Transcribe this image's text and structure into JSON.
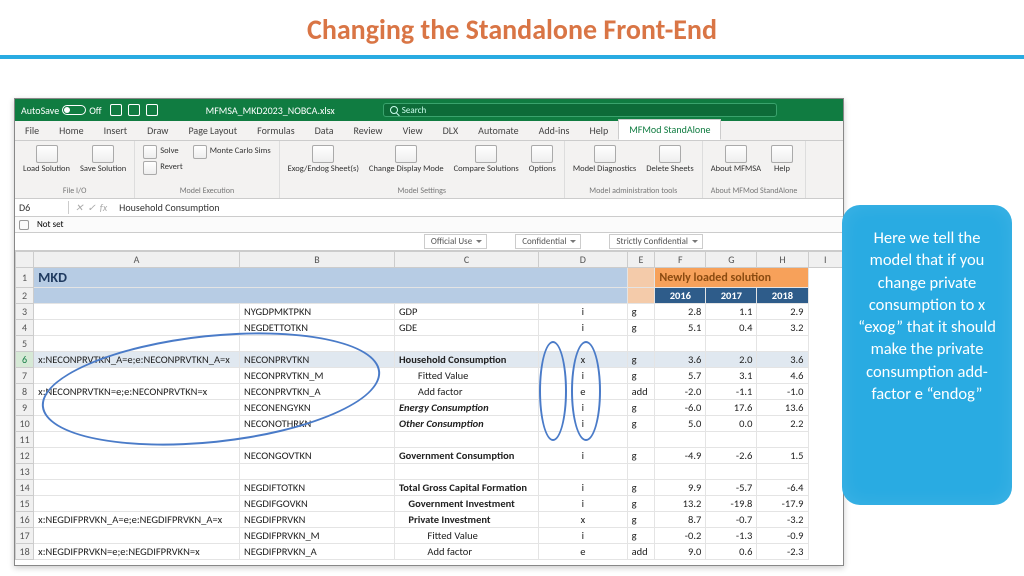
{
  "slide": {
    "title": "Changing the Standalone Front-End"
  },
  "callout": {
    "text": "Here we tell the model that if you change private consumption to x “exog” that it should make the private consumption add-factor e “endog”"
  },
  "titlebar": {
    "autosave": "AutoSave",
    "autosave_state": "Off",
    "filename": "MFMSA_MKD2023_NOBCA.xlsx",
    "search_placeholder": "Search"
  },
  "tabs": [
    "File",
    "Home",
    "Insert",
    "Draw",
    "Page Layout",
    "Formulas",
    "Data",
    "Review",
    "View",
    "DLX",
    "Automate",
    "Add-ins",
    "Help",
    "MFMod StandAlone"
  ],
  "active_tab": "MFMod StandAlone",
  "ribbon": {
    "g1": {
      "label": "File I/O",
      "btns": [
        "Load Solution",
        "Save Solution"
      ]
    },
    "g2": {
      "label": "Model Execution",
      "btns": [
        "Solve",
        "Revert"
      ],
      "extra": "Monte Carlo Sims"
    },
    "g3": {
      "label": "Model Settings",
      "btns": [
        "Exog/Endog Sheet(s)",
        "Change Display Mode",
        "Compare Solutions",
        "Options"
      ]
    },
    "g4": {
      "label": "Model administration tools",
      "btns": [
        "Model Diagnostics",
        "Delete Sheets"
      ]
    },
    "g5": {
      "label": "About MFMod StandAlone",
      "btns": [
        "About MFMSA",
        "Help"
      ]
    }
  },
  "fx": {
    "cellref": "D6",
    "value": "Household Consumption",
    "notset": "Not set"
  },
  "classif": {
    "a": "Official Use",
    "b": "Confidential",
    "c": "Strictly Confidential"
  },
  "cols": [
    "A",
    "B",
    "C",
    "D",
    "E",
    "F",
    "G",
    "H",
    "I"
  ],
  "header": {
    "mkd": "MKD",
    "newsol": "Newly loaded solution",
    "y1": "2016",
    "y2": "2017",
    "y3": "2018"
  },
  "rows": [
    {
      "n": 3,
      "B": "",
      "C": "NYGDPMKTPKN",
      "D": "GDP",
      "E": "i",
      "F": "g",
      "G": "2.8",
      "H": "1.1",
      "I": "2.9"
    },
    {
      "n": 4,
      "B": "",
      "C": "NEGDETTOTKN",
      "D": "GDE",
      "E": "i",
      "F": "g",
      "G": "5.1",
      "H": "0.4",
      "I": "3.2"
    },
    {
      "n": 5,
      "B": "",
      "C": "",
      "D": "",
      "E": "",
      "F": "",
      "G": "",
      "H": "",
      "I": ""
    },
    {
      "n": 6,
      "B": "x:NECONPRVTKN_A=e;e:NECONPRVTKN_A=x",
      "C": "NECONPRVTKN",
      "D": "Household Consumption",
      "Dclass": "bold",
      "E": "x",
      "F": "g",
      "G": "3.6",
      "H": "2.0",
      "I": "3.6",
      "rowclass": "row6"
    },
    {
      "n": 7,
      "B": "",
      "C": "NECONPRVTKN_M",
      "D": "Fitted Value",
      "Dindent": 2,
      "E": "i",
      "F": "g",
      "G": "5.7",
      "H": "3.1",
      "I": "4.6"
    },
    {
      "n": 8,
      "B": "x:NECONPRVTKN=e;e:NECONPRVTKN=x",
      "C": "NECONPRVTKN_A",
      "D": "Add factor",
      "Dindent": 2,
      "E": "e",
      "F": "add",
      "G": "-2.0",
      "H": "-1.1",
      "I": "-1.0"
    },
    {
      "n": 9,
      "B": "",
      "C": "NECONENGYKN",
      "D": "Energy Consumption",
      "Dclass": "bold ital",
      "E": "i",
      "F": "g",
      "G": "-6.0",
      "H": "17.6",
      "I": "13.6"
    },
    {
      "n": 10,
      "B": "",
      "C": "NECONOTHRKN",
      "D": "Other Consumption",
      "Dclass": "bold ital",
      "E": "i",
      "F": "g",
      "G": "5.0",
      "H": "0.0",
      "I": "2.2"
    },
    {
      "n": 11,
      "B": "",
      "C": "",
      "D": "",
      "E": "",
      "F": "",
      "G": "",
      "H": "",
      "I": ""
    },
    {
      "n": 12,
      "B": "",
      "C": "NECONGOVTKN",
      "D": "Government Consumption",
      "Dclass": "bold",
      "E": "i",
      "F": "g",
      "G": "-4.9",
      "H": "-2.6",
      "I": "1.5"
    },
    {
      "n": 13,
      "B": "",
      "C": "",
      "D": "",
      "E": "",
      "F": "",
      "G": "",
      "H": "",
      "I": ""
    },
    {
      "n": 14,
      "B": "",
      "C": "NEGDIFTOTKN",
      "D": "Total Gross Capital Formation",
      "Dclass": "bold",
      "E": "i",
      "F": "g",
      "G": "9.9",
      "H": "-5.7",
      "I": "-6.4"
    },
    {
      "n": 15,
      "B": "",
      "C": "NEGDIFGOVKN",
      "D": "Government Investment",
      "Dclass": "bold",
      "Dindent": 1,
      "E": "i",
      "F": "g",
      "G": "13.2",
      "H": "-19.8",
      "I": "-17.9"
    },
    {
      "n": 16,
      "B": "x:NEGDIFPRVKN_A=e;e:NEGDIFPRVKN_A=x",
      "C": "NEGDIFPRVKN",
      "D": "Private Investment",
      "Dclass": "bold",
      "Dindent": 1,
      "E": "x",
      "F": "g",
      "G": "8.7",
      "H": "-0.7",
      "I": "-3.2"
    },
    {
      "n": 17,
      "B": "",
      "C": "NEGDIFPRVKN_M",
      "D": "Fitted Value",
      "Dindent": 3,
      "E": "i",
      "F": "g",
      "G": "-0.2",
      "H": "-1.3",
      "I": "-0.9"
    },
    {
      "n": 18,
      "B": "x:NEGDIFPRVKN=e;e:NEGDIFPRVKN=x",
      "C": "NEGDIFPRVKN_A",
      "D": "Add factor",
      "Dindent": 3,
      "E": "e",
      "F": "add",
      "G": "9.0",
      "H": "0.6",
      "I": "-2.3"
    }
  ]
}
